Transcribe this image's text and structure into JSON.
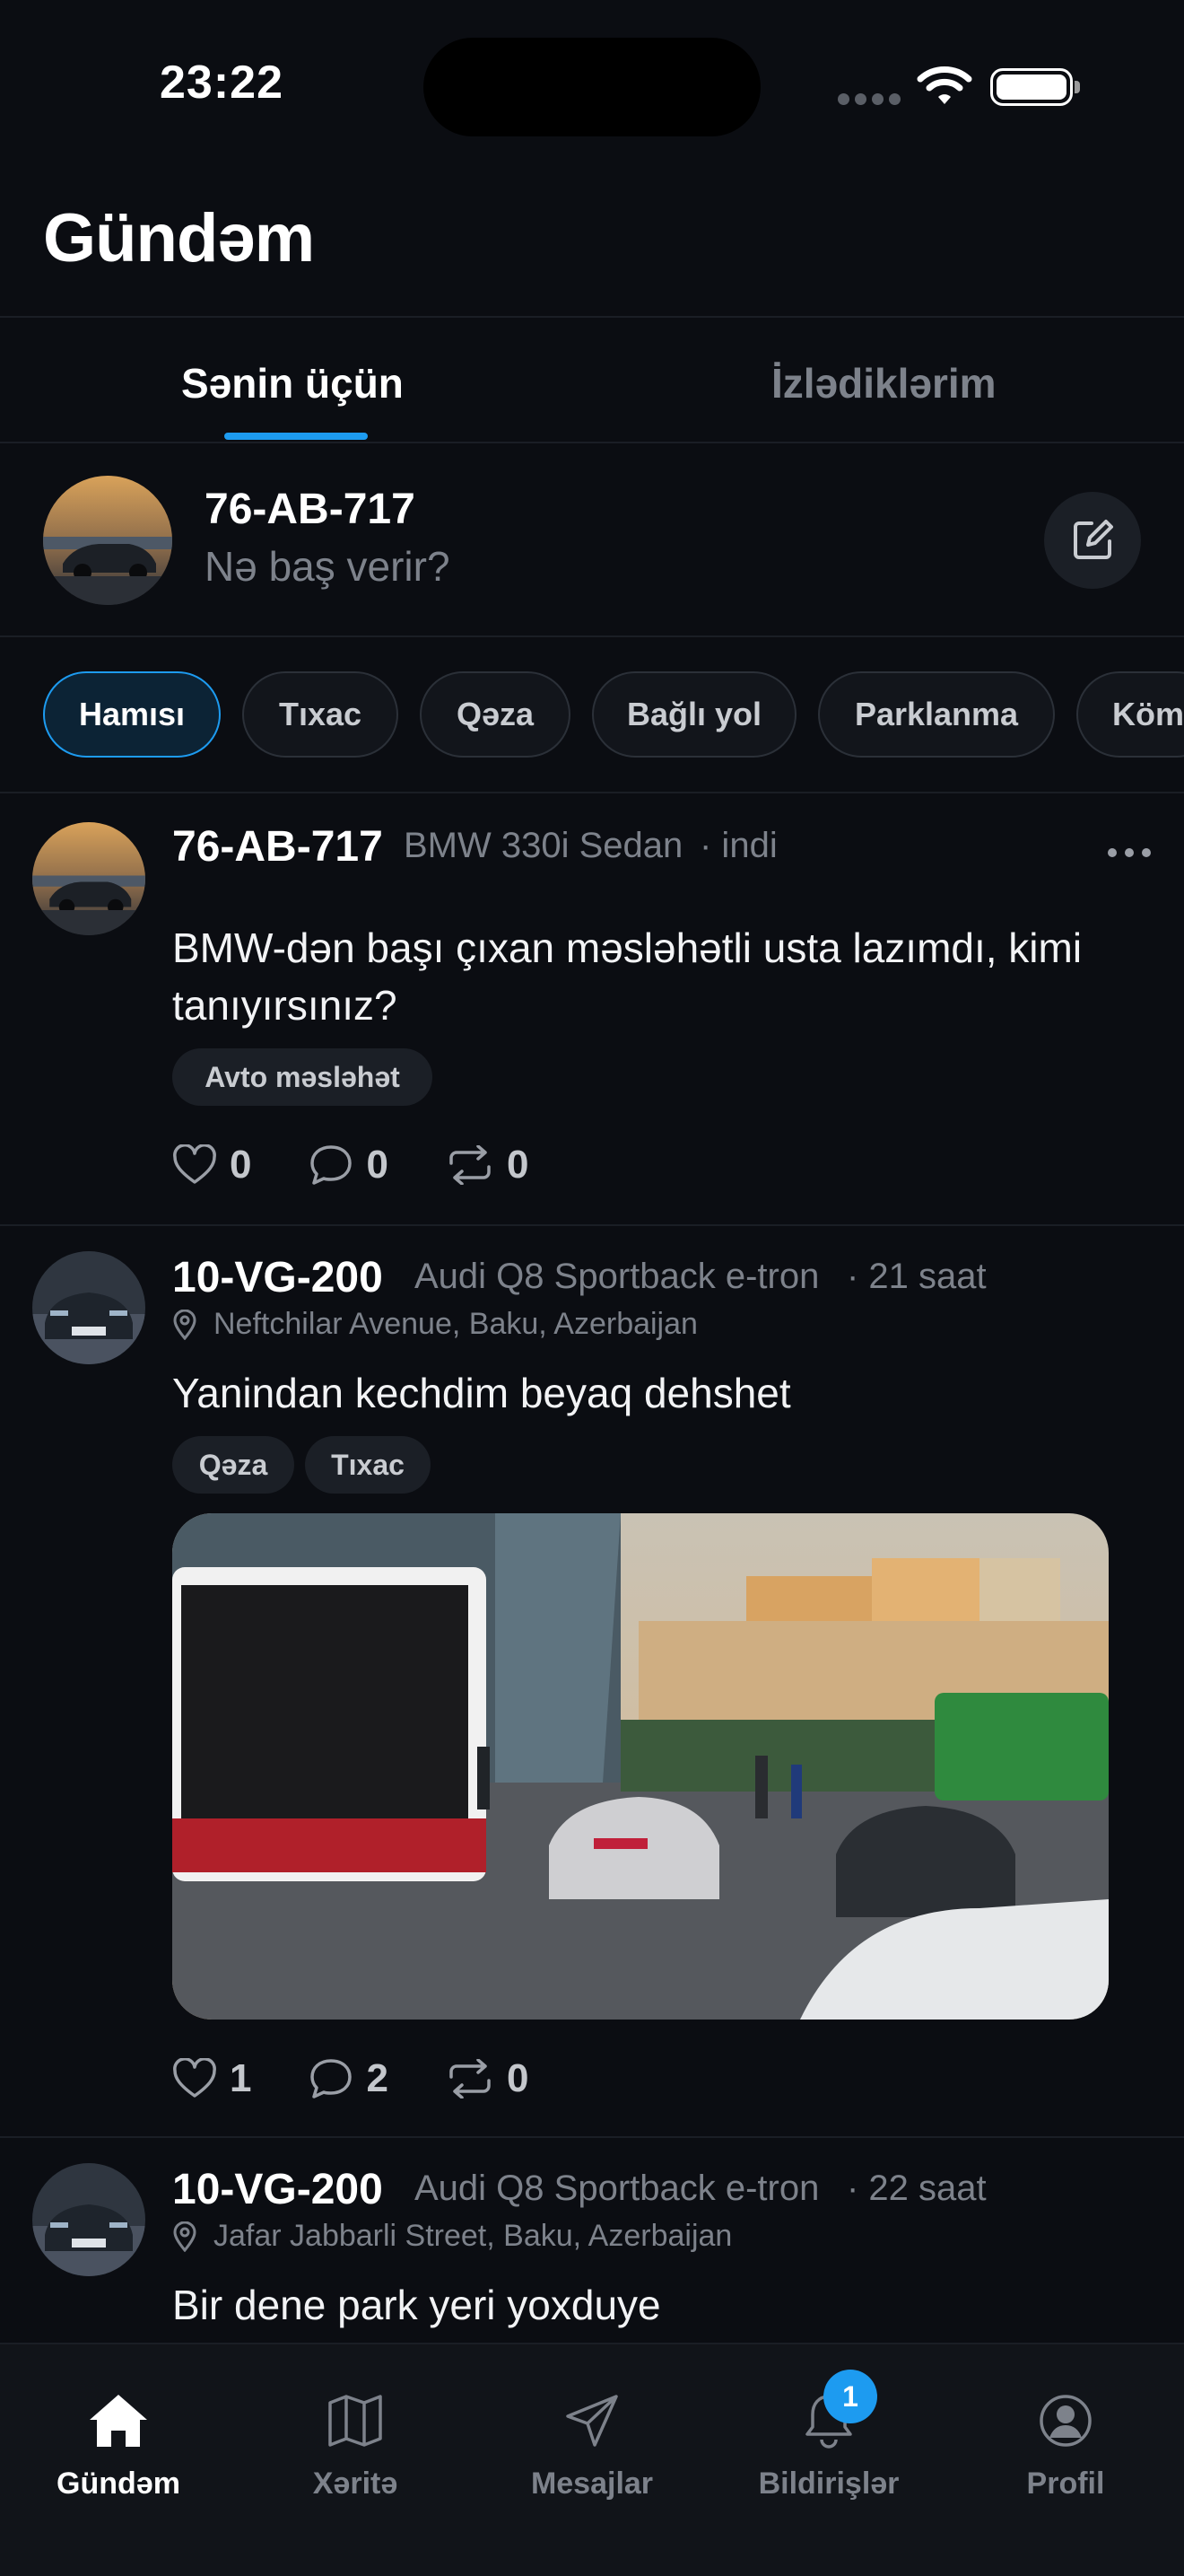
{
  "status_bar": {
    "time": "23:22"
  },
  "header": {
    "title": "Gündəm"
  },
  "tabs": [
    {
      "label": "Sənin üçün",
      "active": true
    },
    {
      "label": "İzlədiklərim",
      "active": false
    }
  ],
  "composer": {
    "plate": "76-AB-717",
    "prompt": "Nə baş verir?"
  },
  "filters": [
    {
      "label": "Hamısı",
      "active": true
    },
    {
      "label": "Tıxac"
    },
    {
      "label": "Qəza"
    },
    {
      "label": "Bağlı yol"
    },
    {
      "label": "Parklanma"
    },
    {
      "label": "Köm"
    }
  ],
  "posts": [
    {
      "plate": "76-AB-717",
      "car": "BMW 330i Sedan",
      "time": "· indi",
      "text": "BMW-dən başı çıxan məsləhətli usta lazımdı, kimi tanıyırsınız?",
      "tags": [
        "Avto məsləhət"
      ],
      "likes": "0",
      "comments": "0",
      "reposts": "0"
    },
    {
      "plate": "10-VG-200",
      "car": "Audi Q8 Sportback e-tron",
      "time": "· 21 saat",
      "location": "Neftchilar Avenue, Baku, Azerbaijan",
      "text": "Yanindan kechdim beyaq dehshet",
      "tags": [
        "Qəza",
        "Tıxac"
      ],
      "likes": "1",
      "comments": "2",
      "reposts": "0"
    },
    {
      "plate": "10-VG-200",
      "car": "Audi Q8 Sportback e-tron",
      "time": "· 22 saat",
      "location": "Jafar Jabbarli Street, Baku, Azerbaijan",
      "text": "Bir dene park yeri yoxduye"
    }
  ],
  "tab_bar": {
    "items": [
      {
        "label": "Gündəm",
        "icon": "home-icon",
        "active": true
      },
      {
        "label": "Xəritə",
        "icon": "map-icon"
      },
      {
        "label": "Mesajlar",
        "icon": "send-icon"
      },
      {
        "label": "Bildirişlər",
        "icon": "bell-icon",
        "badge": "1"
      },
      {
        "label": "Profil",
        "icon": "profile-icon"
      }
    ]
  },
  "colors": {
    "accent": "#1d9bf0",
    "background": "#0b0d12",
    "muted": "#7d828b"
  }
}
